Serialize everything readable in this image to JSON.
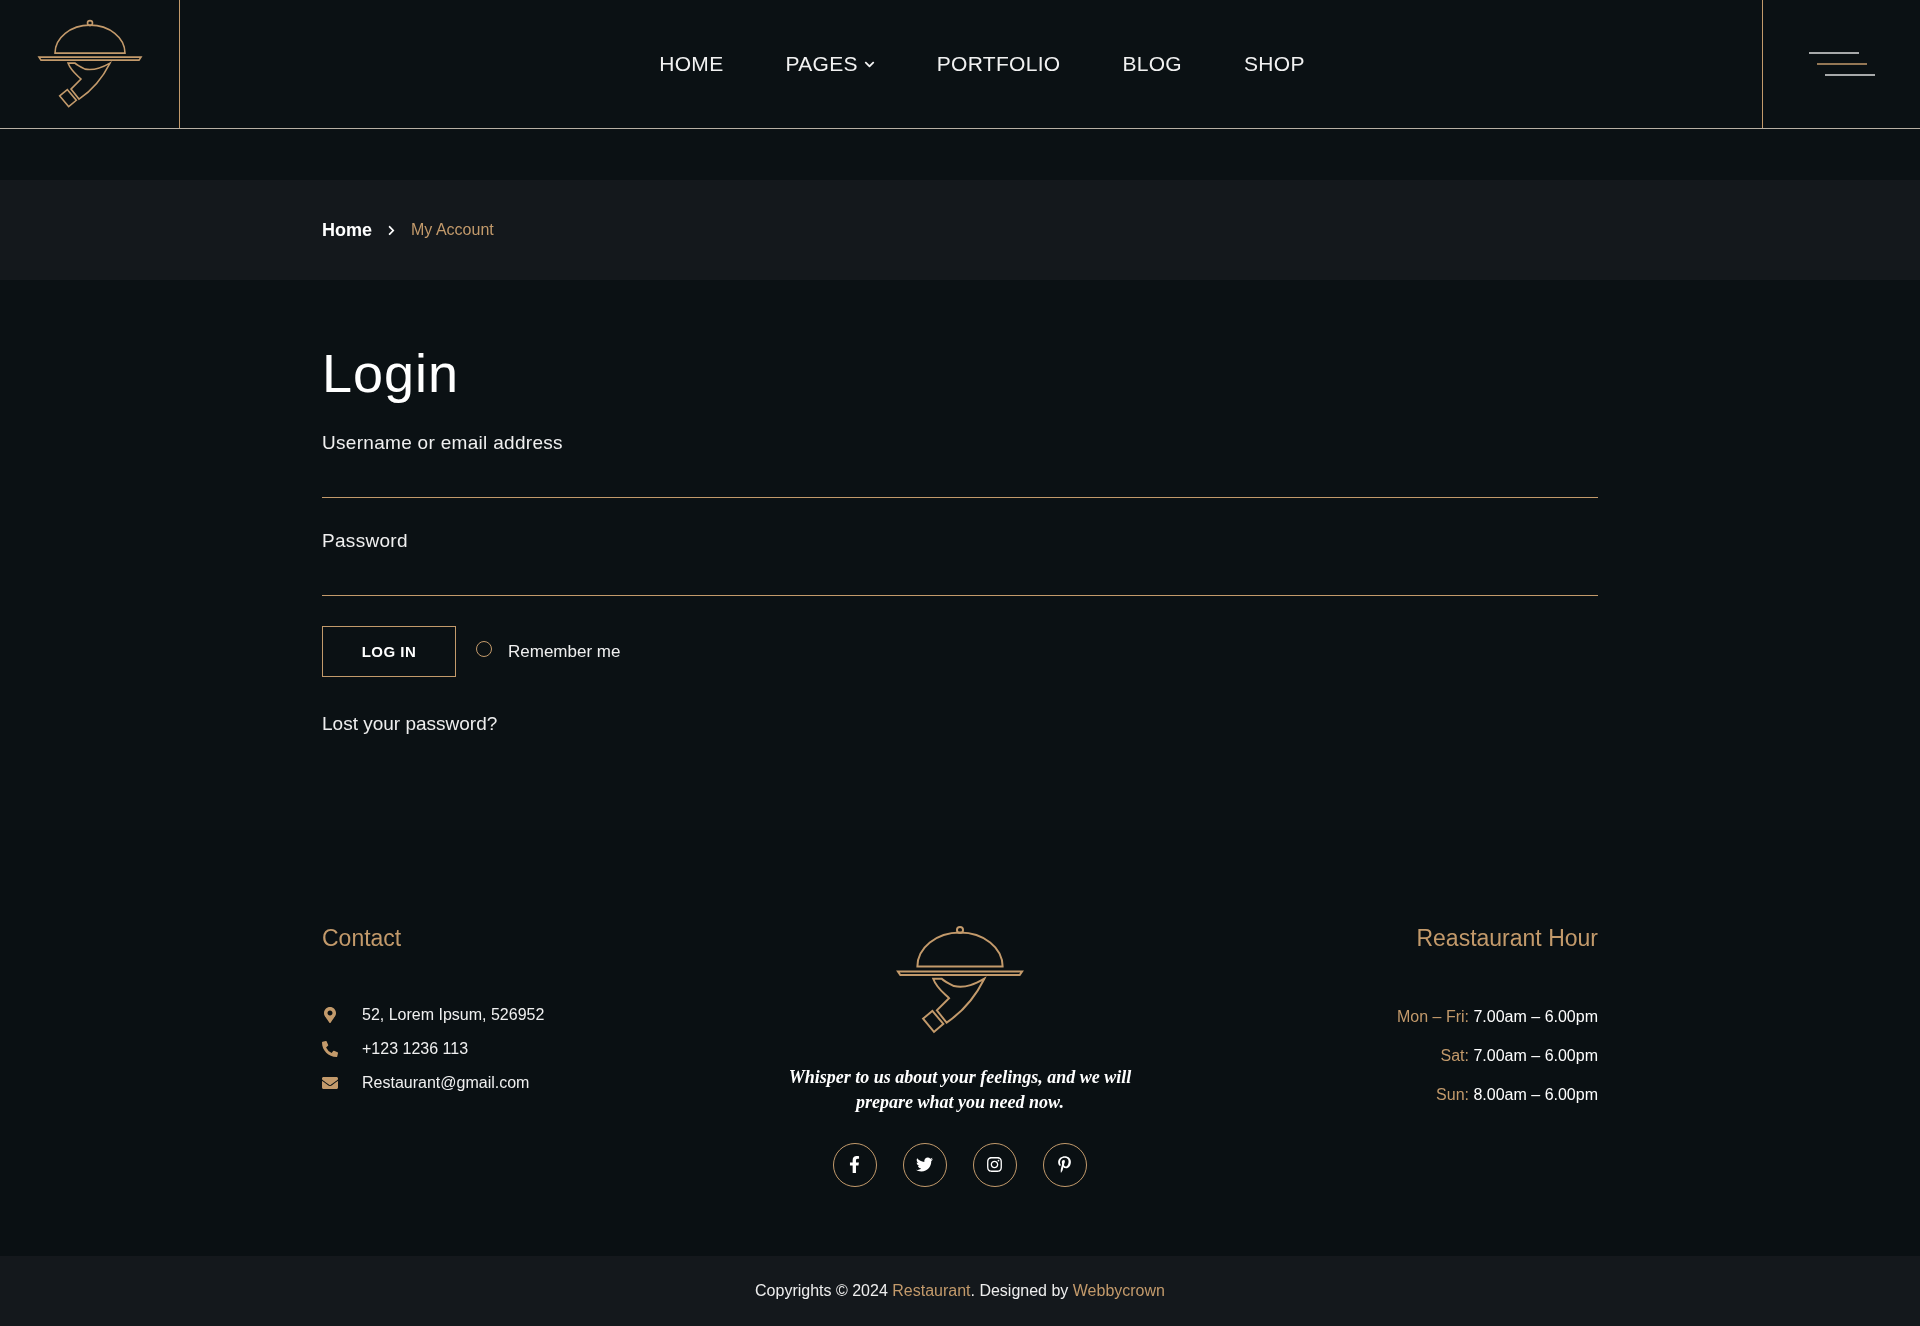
{
  "nav": {
    "items": [
      {
        "label": "HOME",
        "has_dropdown": false
      },
      {
        "label": "PAGES",
        "has_dropdown": true
      },
      {
        "label": "PORTFOLIO",
        "has_dropdown": false
      },
      {
        "label": "BLOG",
        "has_dropdown": false
      },
      {
        "label": "SHOP",
        "has_dropdown": false
      }
    ]
  },
  "breadcrumb": {
    "items": [
      {
        "label": "Home",
        "current": false
      },
      {
        "label": "My Account",
        "current": true
      }
    ]
  },
  "login": {
    "title": "Login",
    "fields": [
      {
        "label": "Username or email address"
      },
      {
        "label": "Password"
      }
    ],
    "button": "LOG IN",
    "remember": {
      "label": "Remember me",
      "checked": false
    },
    "lost_password": "Lost your password?"
  },
  "footer": {
    "contact": {
      "title": "Contact",
      "items": [
        {
          "kind": "address",
          "text": "52, Lorem Ipsum, 526952"
        },
        {
          "kind": "phone",
          "text": "+123 1236 113"
        },
        {
          "kind": "email",
          "text": "Restaurant@gmail.com"
        }
      ]
    },
    "tagline": "Whisper to us about your feelings, and we will prepare what you need now.",
    "social": [
      {
        "kind": "facebook"
      },
      {
        "kind": "twitter"
      },
      {
        "kind": "instagram"
      },
      {
        "kind": "pinterest"
      }
    ],
    "hours": {
      "title": "Reastaurant Hour",
      "items": [
        {
          "day": "Mon – Fri:",
          "time": "7.00am – 6.00pm"
        },
        {
          "day": "Sat:",
          "time": "7.00am – 6.00pm"
        },
        {
          "day": "Sun:",
          "time": "8.00am – 6.00pm"
        }
      ]
    }
  },
  "copyright": {
    "prefix": "Copyrights © 2024 ",
    "site": "Restaurant",
    "middle": ". Designed by ",
    "designer": "Webbycrown"
  }
}
